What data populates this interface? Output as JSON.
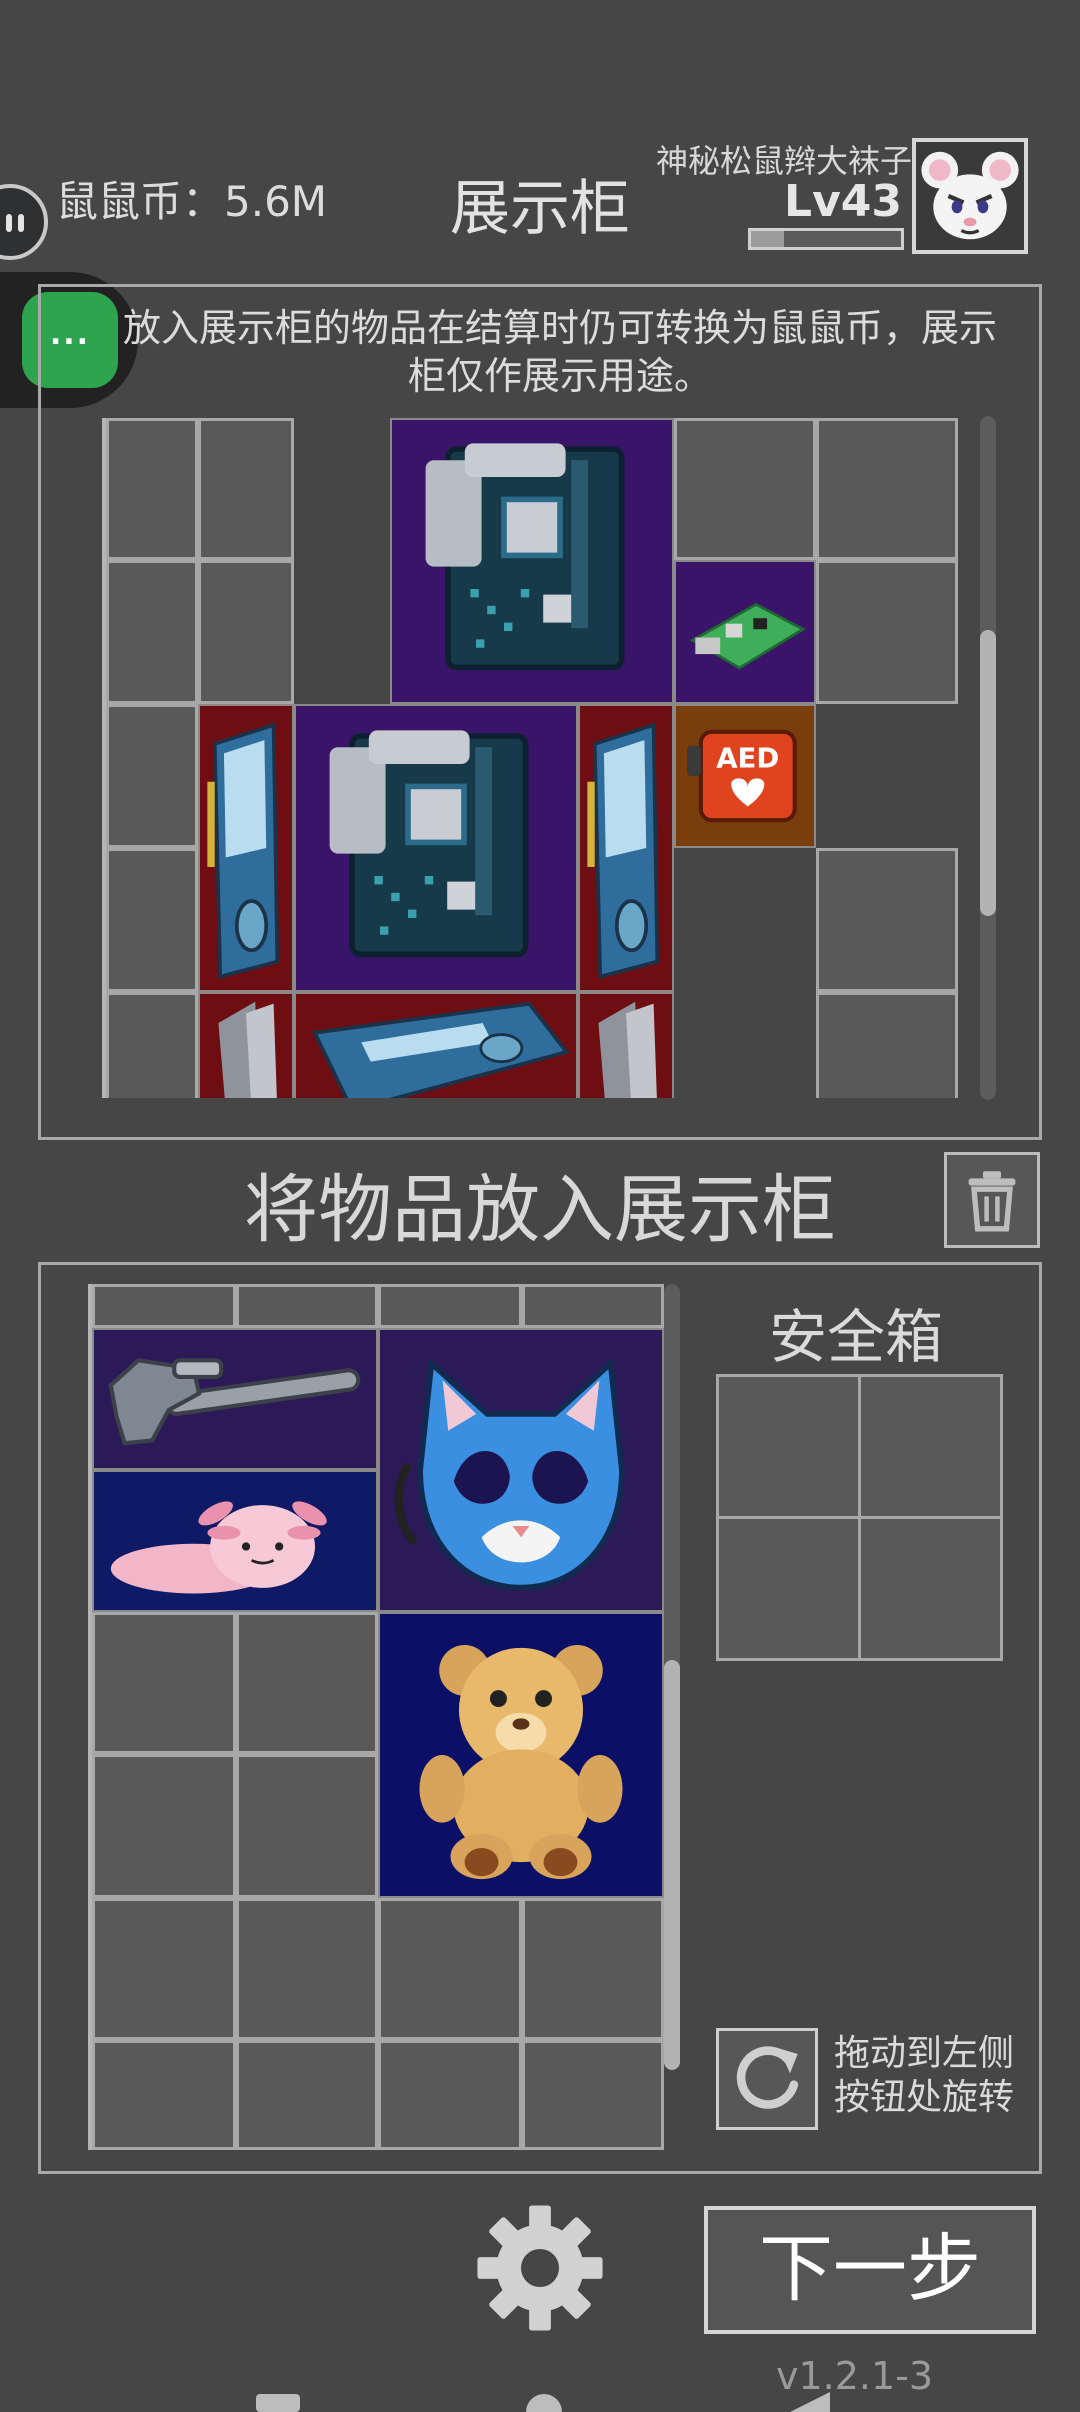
{
  "header": {
    "coins_text": "鼠鼠币：5.6M",
    "title": "展示柜",
    "player_name": "神秘松鼠辫大袜子",
    "level": "Lv43",
    "xp_progress": 0.22
  },
  "overlay": {
    "more_button_label": "..."
  },
  "cabinet": {
    "notice": "放入展示柜的物品在结算时仍可转换为鼠鼠币，展示柜仅作展示用途。",
    "items": [
      {
        "name": "motherboard-item",
        "icon": "motherboard-icon",
        "bg": "#3a1468"
      },
      {
        "name": "raspberry-pi-item",
        "icon": "circuit-board-icon",
        "bg": "#3a1468"
      },
      {
        "name": "aed-item",
        "icon": "aed-icon",
        "label": "AED",
        "bg": "#7a3d0c"
      },
      {
        "name": "graphics-card-item",
        "icon": "graphics-card-icon",
        "bg": "#6e0e12"
      }
    ]
  },
  "add_section": {
    "title": "将物品放入展示柜",
    "trash_icon": "trash-icon"
  },
  "inventory": {
    "items": [
      {
        "name": "pipe-wrench-item",
        "icon": "wrench-icon",
        "bg": "#2c1a58"
      },
      {
        "name": "axolotl-plush-item",
        "icon": "axolotl-icon",
        "bg": "#0e1a66"
      },
      {
        "name": "cat-mask-item",
        "icon": "cat-mask-icon",
        "bg": "#2c1a58"
      },
      {
        "name": "teddy-bear-item",
        "icon": "teddy-bear-icon",
        "bg": "#0b0f66"
      }
    ]
  },
  "safe_box": {
    "title": "安全箱"
  },
  "rotate": {
    "hint_line1": "拖动到左侧",
    "hint_line2": "按钮处旋转"
  },
  "footer": {
    "next_label": "下一步",
    "version": "v1.2.1-3"
  },
  "colors": {
    "background": "#464646",
    "epic_purple": "#3a1468",
    "rare_red": "#6e0e12",
    "blue": "#0b0f66",
    "orange": "#7a3d0c",
    "accent_green": "#2ea44f"
  }
}
